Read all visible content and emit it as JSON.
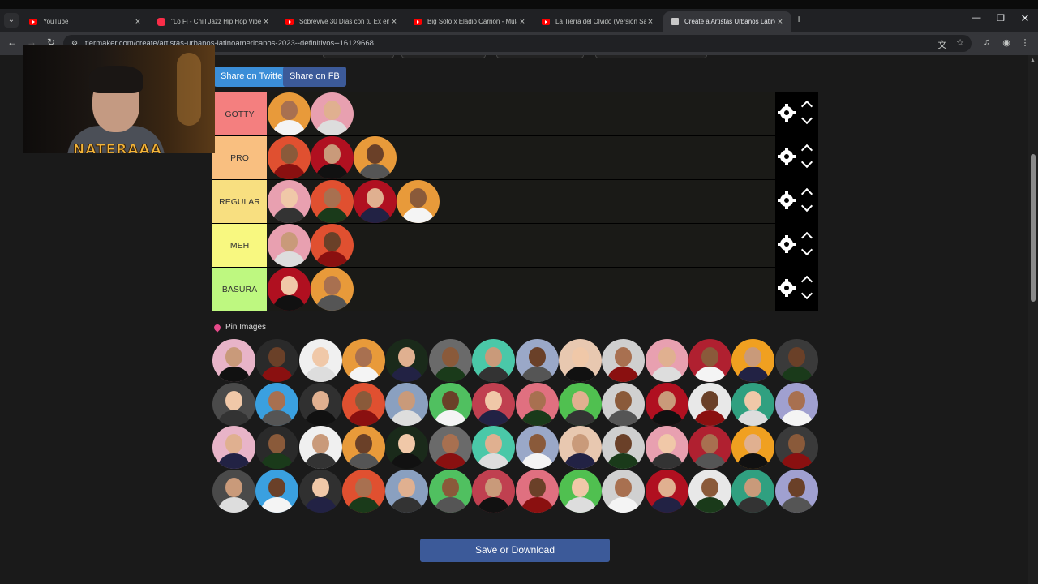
{
  "browser": {
    "tabs": [
      {
        "title": "YouTube",
        "favicon": "youtube-icon",
        "active": false
      },
      {
        "title": "\"Lo Fi - Chill Jazz Hip Hop Vibes",
        "favicon": "music-icon",
        "active": false
      },
      {
        "title": "Sobrevive 30 Días con tu Ex en M",
        "favicon": "youtube-icon",
        "active": false
      },
      {
        "title": "Big Soto x Eladio Carrión - Mula",
        "favicon": "youtube-icon",
        "active": false
      },
      {
        "title": "La Tierra del Olvido (Versión Sa",
        "favicon": "youtube-icon",
        "active": false
      },
      {
        "title": "Create a Artistas Urbanos Latino",
        "favicon": "tiermaker-icon",
        "active": true
      }
    ],
    "new_tab_label": "+",
    "url": "tiermaker.com/create/artistas-urbanos-latinoamericanos-2023--definitivos--16129668"
  },
  "webcam": {
    "overlay_name": "NATERAAA"
  },
  "share": {
    "twitter_label": "Share on Twitter",
    "fb_label": "Share on FB"
  },
  "tiers": [
    {
      "label": "GOTTY",
      "color": "#f47f7f",
      "item_count": 2
    },
    {
      "label": "PRO",
      "color": "#f9bf80",
      "item_count": 3
    },
    {
      "label": "REGULAR",
      "color": "#f8df80",
      "item_count": 4
    },
    {
      "label": "MEH",
      "color": "#f8f880",
      "item_count": 2
    },
    {
      "label": "BASURA",
      "color": "#bef880",
      "item_count": 2
    }
  ],
  "pool": {
    "label": "Pin Images",
    "item_count": 56
  },
  "save_label": "Save or Download",
  "colors": {
    "share_twitter": "#3b8ed8",
    "share_fb": "#3c5a99",
    "save_button": "#3c5a99"
  }
}
